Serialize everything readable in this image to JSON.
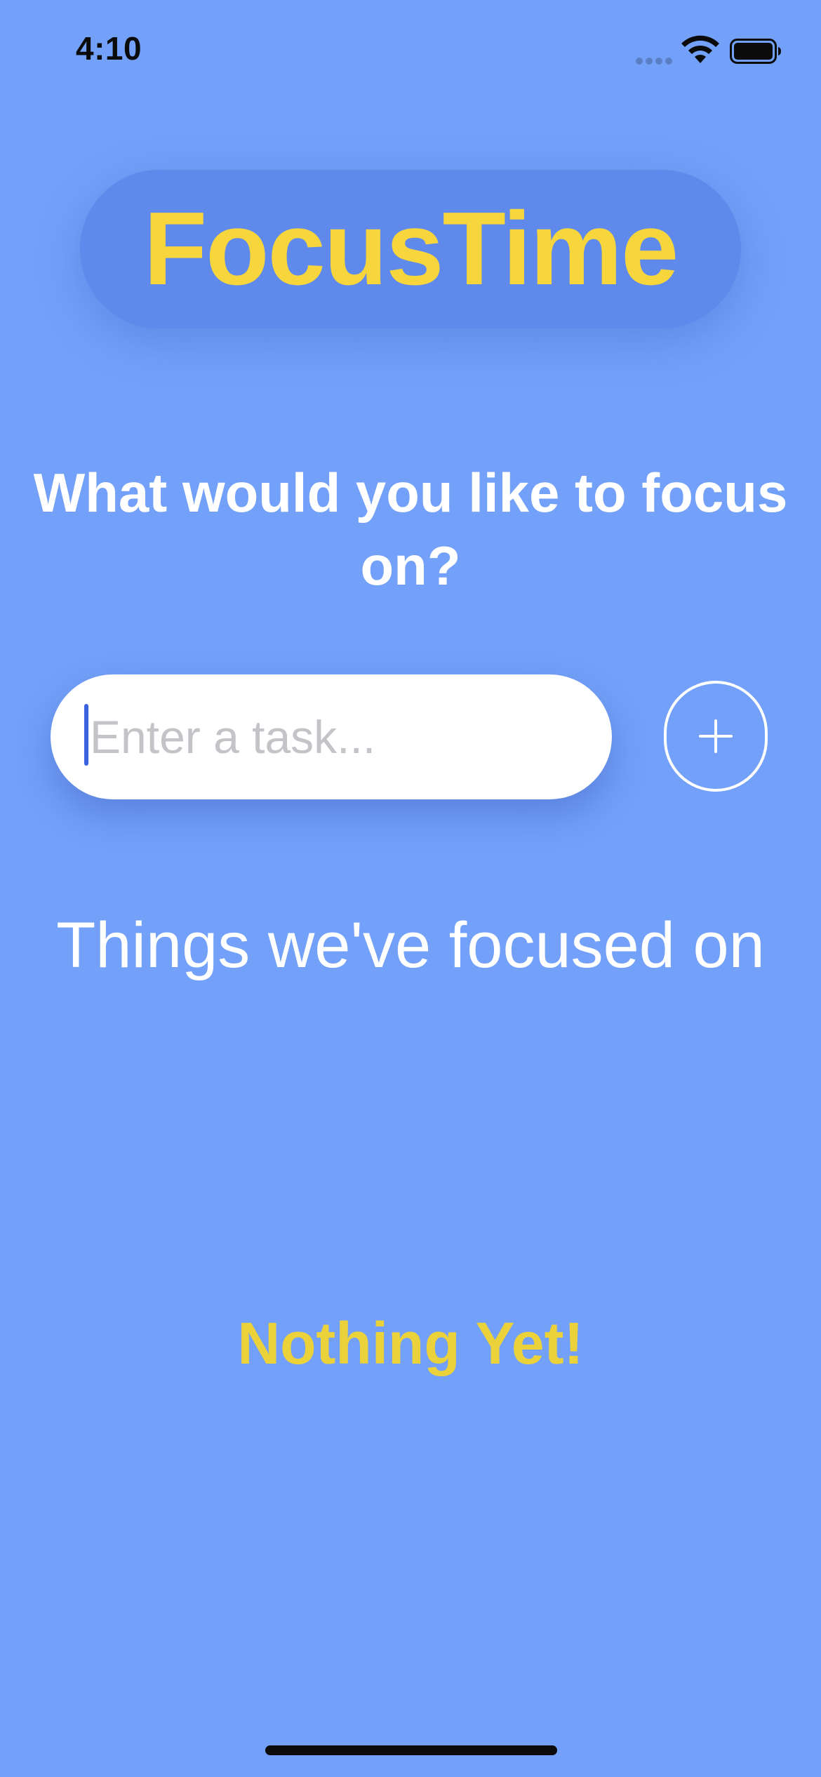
{
  "status_bar": {
    "time": "4:10",
    "icons": [
      "cellular-signal-icon",
      "wifi-icon",
      "battery-icon"
    ]
  },
  "header": {
    "title": "FocusTime"
  },
  "focus_prompt": {
    "question": "What would you like to focus on?"
  },
  "task_input": {
    "value": "",
    "placeholder": "Enter a task..."
  },
  "add_button": {
    "icon": "plus-icon"
  },
  "history": {
    "heading": "Things we've focused on",
    "empty_message": "Nothing Yet!",
    "items": []
  },
  "colors": {
    "background": "#73a0f8",
    "title_pill": "#5f89eb",
    "accent_yellow": "#f6d63c",
    "empty_yellow": "#ecd23a",
    "text_white": "#ffffff",
    "caret_blue": "#3a63e0"
  }
}
